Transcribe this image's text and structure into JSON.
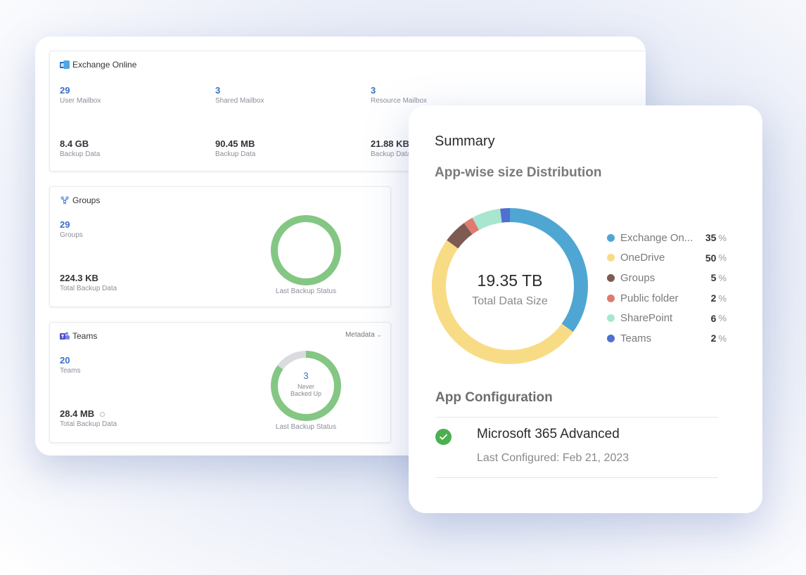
{
  "exchange": {
    "title": "Exchange Online",
    "icon": "exchange-icon",
    "stats": [
      {
        "count": "29",
        "count_label": "User Mailbox",
        "size": "8.4 GB",
        "size_label": "Backup Data"
      },
      {
        "count": "3",
        "count_label": "Shared Mailbox",
        "size": "90.45 MB",
        "size_label": "Backup Data"
      },
      {
        "count": "3",
        "count_label": "Resource Mailbox",
        "size": "21.88 KB",
        "size_label": "Backup Data"
      }
    ]
  },
  "groups": {
    "title": "Groups",
    "icon": "groups-icon",
    "count": "29",
    "count_label": "Groups",
    "size": "224.3 KB",
    "size_label": "Total Backup Data",
    "status_caption": "Last Backup Status",
    "status": {
      "backed_up_fraction": 1.0,
      "color": "#84c684"
    }
  },
  "teams": {
    "title": "Teams",
    "icon": "teams-icon",
    "dropdown": "Metadata",
    "count": "20",
    "count_label": "Teams",
    "size": "28.4 MB",
    "size_label": "Total Backup Data",
    "status_caption": "Last Backup Status",
    "never_count": "3",
    "never_label_1": "Never",
    "never_label_2": "Backed Up",
    "status": {
      "never_fraction": 0.15,
      "color": "#84c684",
      "never_color": "#d9dbde"
    }
  },
  "summary": {
    "title": "Summary",
    "distribution_title": "App-wise size Distribution",
    "total": "19.35 TB",
    "total_label": "Total Data Size",
    "unit": "%",
    "config_title": "App Configuration",
    "config_name": "Microsoft 365 Advanced",
    "config_date": "Last Configured: Feb 21, 2023"
  },
  "chart_data": {
    "type": "pie",
    "title": "App-wise size Distribution",
    "center_text": "19.35 TB",
    "center_subtext": "Total Data Size",
    "legend_position": "right",
    "categories": [
      "Exchange On...",
      "OneDrive",
      "Groups",
      "Public folder",
      "SharePoint",
      "Teams"
    ],
    "values": [
      35,
      50,
      5,
      2,
      6,
      2
    ],
    "colors": [
      "#4fa6d3",
      "#f8dc85",
      "#7d5b52",
      "#e07a6e",
      "#a8e6cf",
      "#4f6fd1"
    ]
  }
}
